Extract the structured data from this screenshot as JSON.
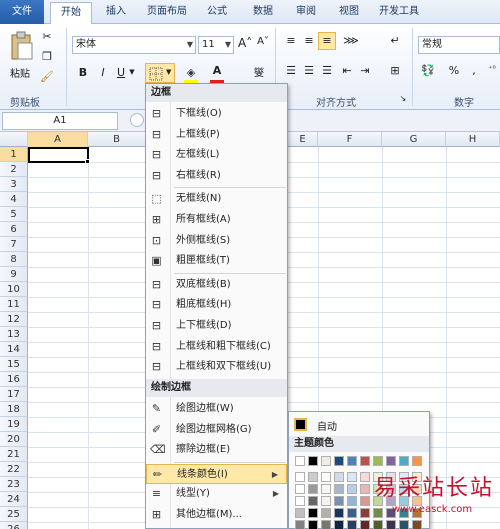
{
  "tabs": [
    "文件",
    "开始",
    "插入",
    "页面布局",
    "公式",
    "数据",
    "审阅",
    "视图",
    "开发工具"
  ],
  "ribbon": {
    "paste_label": "粘贴",
    "clipboard_label": "剪贴板",
    "font_name": "宋体",
    "font_size": "11",
    "bold": "B",
    "italic": "I",
    "underline": "U",
    "align_group_label": "对齐方式",
    "number_group_label": "数字",
    "number_format": "常规",
    "percent": "%"
  },
  "namebox": "A1",
  "columns": [
    "A",
    "B",
    "E",
    "F",
    "G",
    "H"
  ],
  "rows": [
    "1",
    "2",
    "3",
    "4",
    "5",
    "6",
    "7",
    "8",
    "9",
    "10",
    "11",
    "12",
    "13",
    "14",
    "15",
    "16",
    "17",
    "18",
    "19",
    "20",
    "21",
    "22",
    "23",
    "24",
    "25",
    "26"
  ],
  "menu": {
    "heading_borders": "边框",
    "heading_draw": "绘制边框",
    "items": [
      "下框线(O)",
      "上框线(P)",
      "左框线(L)",
      "右框线(R)",
      "无框线(N)",
      "所有框线(A)",
      "外侧框线(S)",
      "粗匣框线(T)",
      "双底框线(B)",
      "粗底框线(H)",
      "上下框线(D)",
      "上框线和粗下框线(C)",
      "上框线和双下框线(U)"
    ],
    "draw_items": [
      "绘图边框(W)",
      "绘图边框网格(G)",
      "擦除边框(E)",
      "线条颜色(I)",
      "线型(Y)",
      "其他边框(M)..."
    ]
  },
  "colors": {
    "auto_label": "自动",
    "theme_label": "主题颜色",
    "theme_row": [
      "#ffffff",
      "#000000",
      "#eeece1",
      "#1f497d",
      "#4f81bd",
      "#c0504d",
      "#9bbb59",
      "#8064a2",
      "#4bacc6",
      "#f79646"
    ]
  },
  "watermark": "易采站长站",
  "watermark_url": "www.easck.com"
}
